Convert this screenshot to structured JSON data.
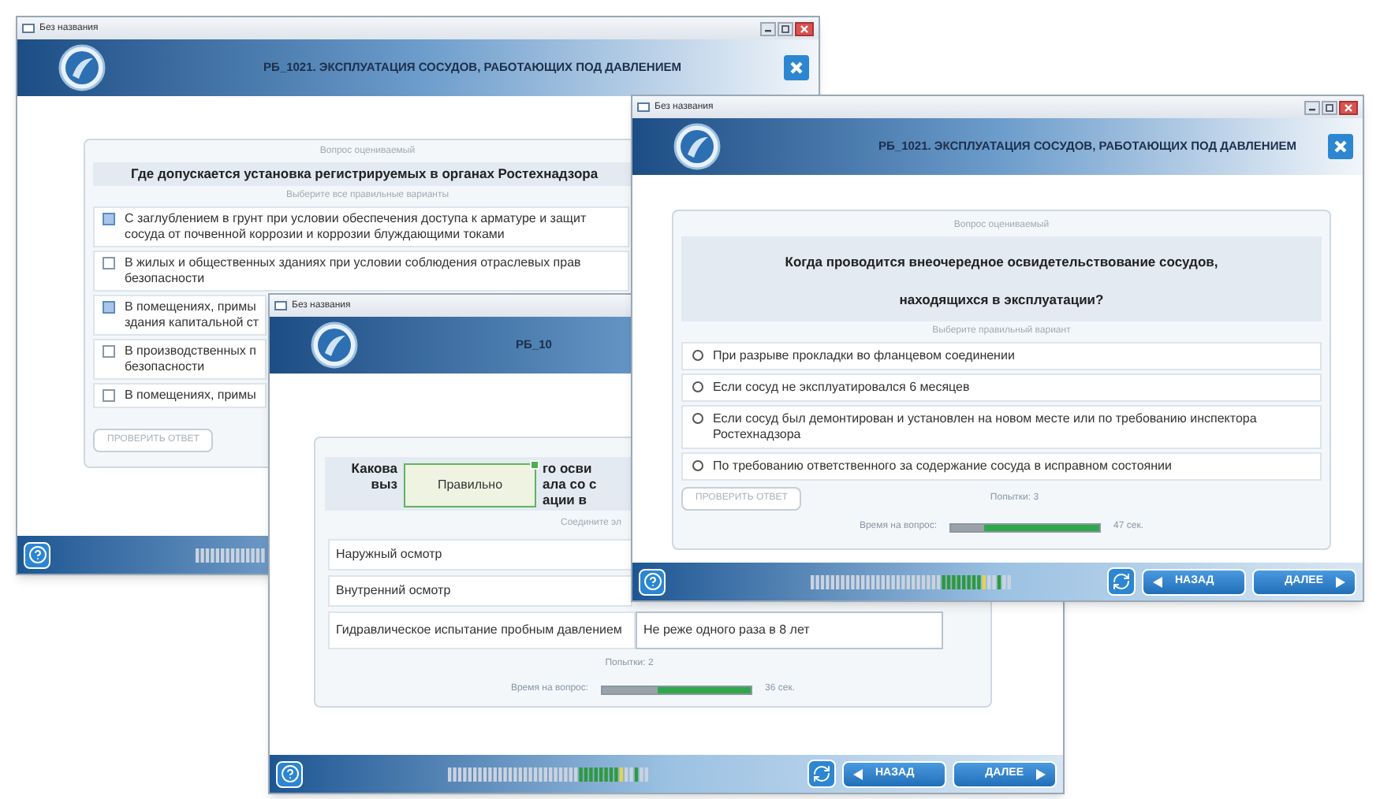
{
  "windows": [
    {
      "kind": "checkbox_quiz",
      "title": "Без названия",
      "window_controls": true,
      "header": "РБ_1021. ЭКСПЛУАТАЦИЯ СОСУДОВ, РАБОТАЮЩИХ ПОД ДАВЛЕНИЕМ",
      "header_close": true,
      "status": "Вопрос оцениваемый",
      "question": "Где допускается установка регистрируемых в органах Ростехнадзора",
      "hint": "Выберите все правильные варианты",
      "options": [
        {
          "lines": [
            "С заглублением в грунт при условии обеспечения доступа к арматуре и защит",
            "сосуда от почвенной коррозии и коррозии блуждающими токами"
          ],
          "checked": true
        },
        {
          "lines": [
            "В жилых и общественных зданиях при условии соблюдения отраслевых прав",
            "безопасности"
          ],
          "checked": false
        },
        {
          "lines": [
            "В помещениях, примы",
            "здания капитальной ст"
          ],
          "checked": true
        },
        {
          "lines": [
            "В производственных п",
            "безопасности"
          ],
          "checked": false
        },
        {
          "lines": [
            "В помещениях, примы"
          ],
          "checked": false
        }
      ],
      "check_button": "ПРОВЕРИТЬ ОТВЕТ"
    },
    {
      "kind": "matching_quiz",
      "title": "Без названия",
      "header": "РБ_10",
      "question_parts": [
        {
          "left": "Какова",
          "right": "го осви"
        },
        {
          "left": "выз",
          "right": "ала со с"
        },
        {
          "right": "ации в"
        }
      ],
      "popup": "Правильно",
      "hint": "Соедините эл",
      "pairs": [
        {
          "left": "Наружный осмотр"
        },
        {
          "left": "Внутренний осмотр"
        },
        {
          "left": "Гидравлическое испытание пробным давлением",
          "right": "Не реже одного раза в 8 лет"
        }
      ],
      "attempts": "Попытки: 2",
      "timer_label": "Время на вопрос:",
      "timer": {
        "level": 0.37
      },
      "timer_reading": "36 сек.",
      "nav": {
        "back": "НАЗАД",
        "next": "ДАЛЕЕ"
      }
    },
    {
      "kind": "radio_quiz",
      "title": "Без названия",
      "window_controls": true,
      "header": "РБ_1021. ЭКСПЛУАТАЦИЯ СОСУДОВ, РАБОТАЮЩИХ ПОД ДАВЛЕНИЕМ",
      "header_close": true,
      "status": "Вопрос оцениваемый",
      "question": "Когда проводится внеочередное освидетельствование сосудов, находящихся в эксплуатации?",
      "hint": "Выберите правильный вариант",
      "options": [
        {
          "lines": [
            "При разрыве прокладки во фланцевом соединении"
          ],
          "selected": false
        },
        {
          "lines": [
            "Если сосуд не эксплуатировался 6 месяцев"
          ],
          "selected": false
        },
        {
          "lines": [
            "Если сосуд был демонтирован и установлен на новом месте или по требованию инспектора",
            "Ростехнадзора"
          ],
          "selected": false
        },
        {
          "lines": [
            "По требованию ответственного за содержание сосуда в исправном состоянии"
          ],
          "selected": false
        }
      ],
      "check_button": "ПРОВЕРИТЬ ОТВЕТ",
      "attempts": "Попытки: 3",
      "timer_label": "Время на вопрос:",
      "timer": {
        "level": 0.22
      },
      "timer_reading": "47 сек.",
      "nav": {
        "back": "НАЗАД",
        "next": "ДАЛЕЕ"
      }
    }
  ]
}
